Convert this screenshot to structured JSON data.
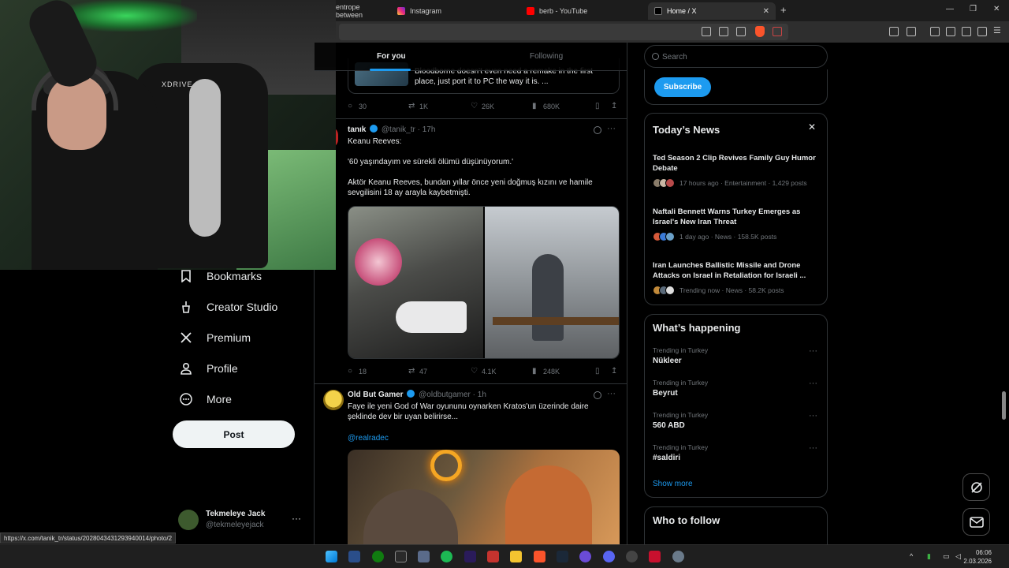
{
  "browser": {
    "tabs": [
      {
        "label": "entrope between",
        "active": false
      },
      {
        "label": "Instagram",
        "active": false
      },
      {
        "label": "berb - YouTube",
        "active": false
      },
      {
        "label": "Home / X",
        "active": true
      }
    ],
    "new_tab": "+",
    "window_controls": [
      "—",
      "❐",
      "✕"
    ]
  },
  "status_url": "https://x.com/tanik_tr/status/2028043431293940014/photo/2",
  "feed_tabs": {
    "for_you": "For you",
    "following": "Following"
  },
  "nav": [
    {
      "label": "Bookmarks",
      "icon": "bookmark-icon"
    },
    {
      "label": "Creator Studio",
      "icon": "creator-studio-icon"
    },
    {
      "label": "Premium",
      "icon": "x-logo-icon"
    },
    {
      "label": "Profile",
      "icon": "profile-icon"
    },
    {
      "label": "More",
      "icon": "more-circle-icon"
    }
  ],
  "post_button": "Post",
  "account": {
    "name": "Tekmeleye Jack",
    "handle": "@tekmeleyejack",
    "more": "···"
  },
  "tweets": [
    {
      "quote_text": "Bloodborne doesn't even need a remake in the first place, just port it to PC the way it is.  ...",
      "actions": {
        "replies": "30",
        "reposts": "1K",
        "likes": "26K",
        "views": "680K"
      }
    },
    {
      "name": "tanık",
      "handle": "@tanik_tr",
      "time": "· 17h",
      "text": "Keanu Reeves:\n\n'60 yaşındayım ve sürekli ölümü düşünüyorum.'\n\nAktör Keanu Reeves, bundan yıllar önce yeni doğmuş kızını ve hamile sevgilisini 18 ay arayla kaybetmişti.",
      "actions": {
        "replies": "18",
        "reposts": "47",
        "likes": "4.1K",
        "views": "248K"
      }
    },
    {
      "name": "Old But Gamer",
      "handle": "@oldbutgamer",
      "time": "· 1h",
      "text": "Faye ile yeni God of War oyununu oynarken Kratos'un üzerinde daire şeklinde dev bir uyan belirirse...",
      "mention": "@realradec"
    }
  ],
  "right": {
    "search_placeholder": "Search",
    "subscribe": "Subscribe",
    "news": {
      "title": "Today’s News",
      "close": "✕",
      "items": [
        {
          "title": "Ted Season 2 Clip Revives Family Guy Humor Debate",
          "meta": "17 hours ago · Entertainment · 1,429 posts"
        },
        {
          "title": "Naftali Bennett Warns Turkey Emerges as Israel's New Iran Threat",
          "meta": "1 day ago · News · 158.5K posts"
        },
        {
          "title": "Iran Launches Ballistic Missile and Drone Attacks on Israel in Retaliation for Israeli ...",
          "meta": "Trending now · News · 58.2K posts"
        }
      ]
    },
    "happening": {
      "title": "What’s happening",
      "items": [
        {
          "context": "Trending in Turkey",
          "name": "Nükleer"
        },
        {
          "context": "Trending in Turkey",
          "name": "Beyrut"
        },
        {
          "context": "Trending in Turkey",
          "name": "560 ABD"
        },
        {
          "context": "Trending in Turkey",
          "name": "#saldiri"
        }
      ],
      "show_more": "Show more"
    },
    "follow": {
      "title": "Who to follow"
    }
  },
  "cam": {
    "chair_brand": "XDRIVE"
  },
  "taskbar": {
    "time": "06:06",
    "date": "2.03.2026",
    "tray_up": "^"
  },
  "colors": {
    "accent": "#1d9bf0",
    "bg": "#000000",
    "border": "#2f3336",
    "muted": "#71767b",
    "text": "#e7e9ea"
  }
}
